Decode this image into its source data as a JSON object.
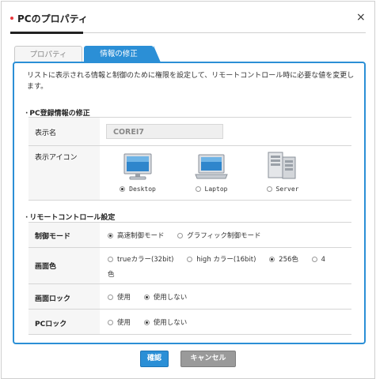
{
  "dialog": {
    "title": "PCのプロパティ",
    "close_label": "×"
  },
  "tabs": [
    {
      "label": "プロパティ",
      "active": false
    },
    {
      "label": "情報の修正",
      "active": true
    }
  ],
  "description": "リストに表示される情報と制御のために権限を設定して、リモートコントロール時に必要な値を変更します。",
  "pc_section": {
    "title": "PC登録情報の修正",
    "name_label": "表示名",
    "name_value": "COREI7",
    "icon_label": "表示アイコン",
    "icons": [
      {
        "label": "Desktop",
        "icon": "desktop-monitor-icon",
        "selected": true
      },
      {
        "label": "Laptop",
        "icon": "laptop-icon",
        "selected": false
      },
      {
        "label": "Server",
        "icon": "server-icon",
        "selected": false
      }
    ]
  },
  "remote_section": {
    "title": "リモートコントロール設定",
    "control_mode": {
      "label": "制御モード",
      "options": [
        {
          "label": "高速制御モード",
          "selected": true
        },
        {
          "label": "グラフィック制御モード",
          "selected": false
        }
      ]
    },
    "color": {
      "label": "画面色",
      "options": [
        {
          "label": "trueカラー(32bit)",
          "selected": false
        },
        {
          "label": "high カラー(16bit)",
          "selected": false
        },
        {
          "label": "256色",
          "selected": true
        },
        {
          "label": "4",
          "selected": false
        }
      ],
      "wrap_text": "色"
    },
    "screen_lock": {
      "label": "画面ロック",
      "options": [
        {
          "label": "使用",
          "selected": false
        },
        {
          "label": "使用しない",
          "selected": true
        }
      ]
    },
    "pc_lock": {
      "label": "PCロック",
      "options": [
        {
          "label": "使用",
          "selected": false
        },
        {
          "label": "使用しない",
          "selected": true
        }
      ]
    }
  },
  "buttons": {
    "ok": "確認",
    "cancel": "キャンセル"
  },
  "colors": {
    "accent": "#2b8fd6",
    "title_dot": "#e8383d",
    "cancel_button": "#9a9a9a"
  }
}
